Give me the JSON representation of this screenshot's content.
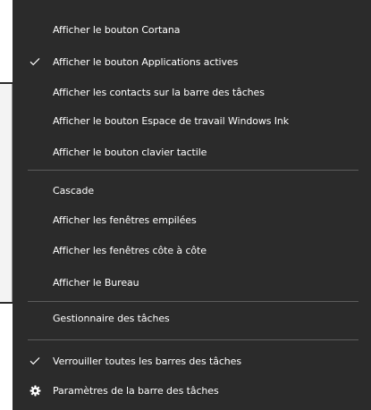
{
  "menu": {
    "items": [
      {
        "label": "Afficher le bouton Cortana",
        "checked": false
      },
      {
        "label": "Afficher le bouton Applications actives",
        "checked": true
      },
      {
        "label": "Afficher les contacts sur la barre des tâches",
        "checked": false
      },
      {
        "label": "Afficher le bouton Espace de travail Windows Ink",
        "checked": false
      },
      {
        "label": "Afficher le bouton clavier tactile",
        "checked": false
      },
      {
        "label": "Cascade",
        "checked": false
      },
      {
        "label": "Afficher les fenêtres empilées",
        "checked": false
      },
      {
        "label": "Afficher les fenêtres côte à côte",
        "checked": false
      },
      {
        "label": "Afficher le Bureau",
        "checked": false
      },
      {
        "label": "Gestionnaire des tâches",
        "checked": false
      },
      {
        "label": "Verrouiller toutes les barres des tâches",
        "checked": true
      },
      {
        "label": "Paramètres de la barre des tâches",
        "icon": "gear-icon"
      }
    ]
  },
  "colors": {
    "menu_background": "#2b2b2b",
    "text": "#ffffff",
    "separator": "#5c5c5c"
  }
}
